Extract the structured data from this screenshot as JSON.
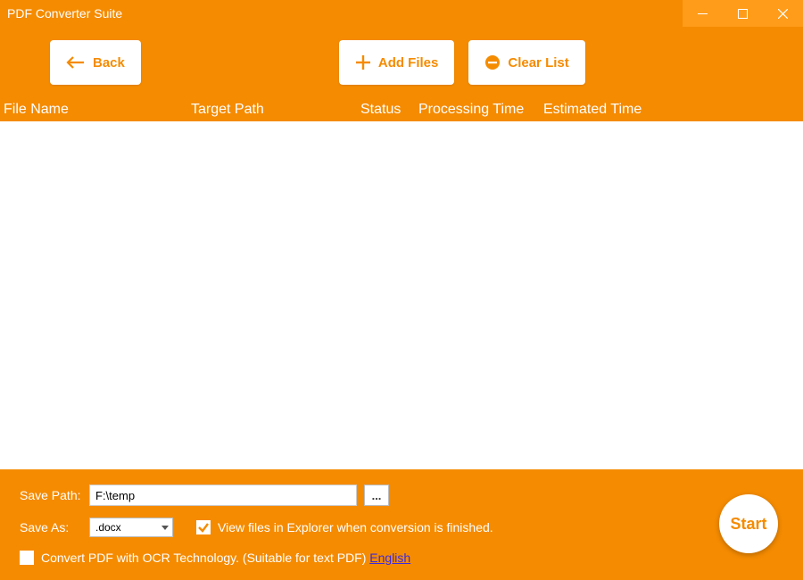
{
  "window": {
    "title": "PDF Converter Suite"
  },
  "toolbar": {
    "back_label": "Back",
    "add_label": "Add Files",
    "clear_label": "Clear List"
  },
  "columns": {
    "name": "File Name",
    "target": "Target Path",
    "status": "Status",
    "processing": "Processing Time",
    "estimated": "Estimated Time"
  },
  "bottom": {
    "save_path_label": "Save Path:",
    "save_path_value": "F:\\temp",
    "browse_label": "...",
    "save_as_label": "Save As:",
    "save_as_value": ".docx",
    "view_explorer_label": "View files in Explorer when conversion is finished.",
    "ocr_label": "Convert PDF with OCR Technology. (Suitable for text PDF)",
    "ocr_lang": "English",
    "start_label": "Start"
  },
  "colors": {
    "primary": "#F58B00",
    "winbtn_bg": "#FF9C1A"
  }
}
